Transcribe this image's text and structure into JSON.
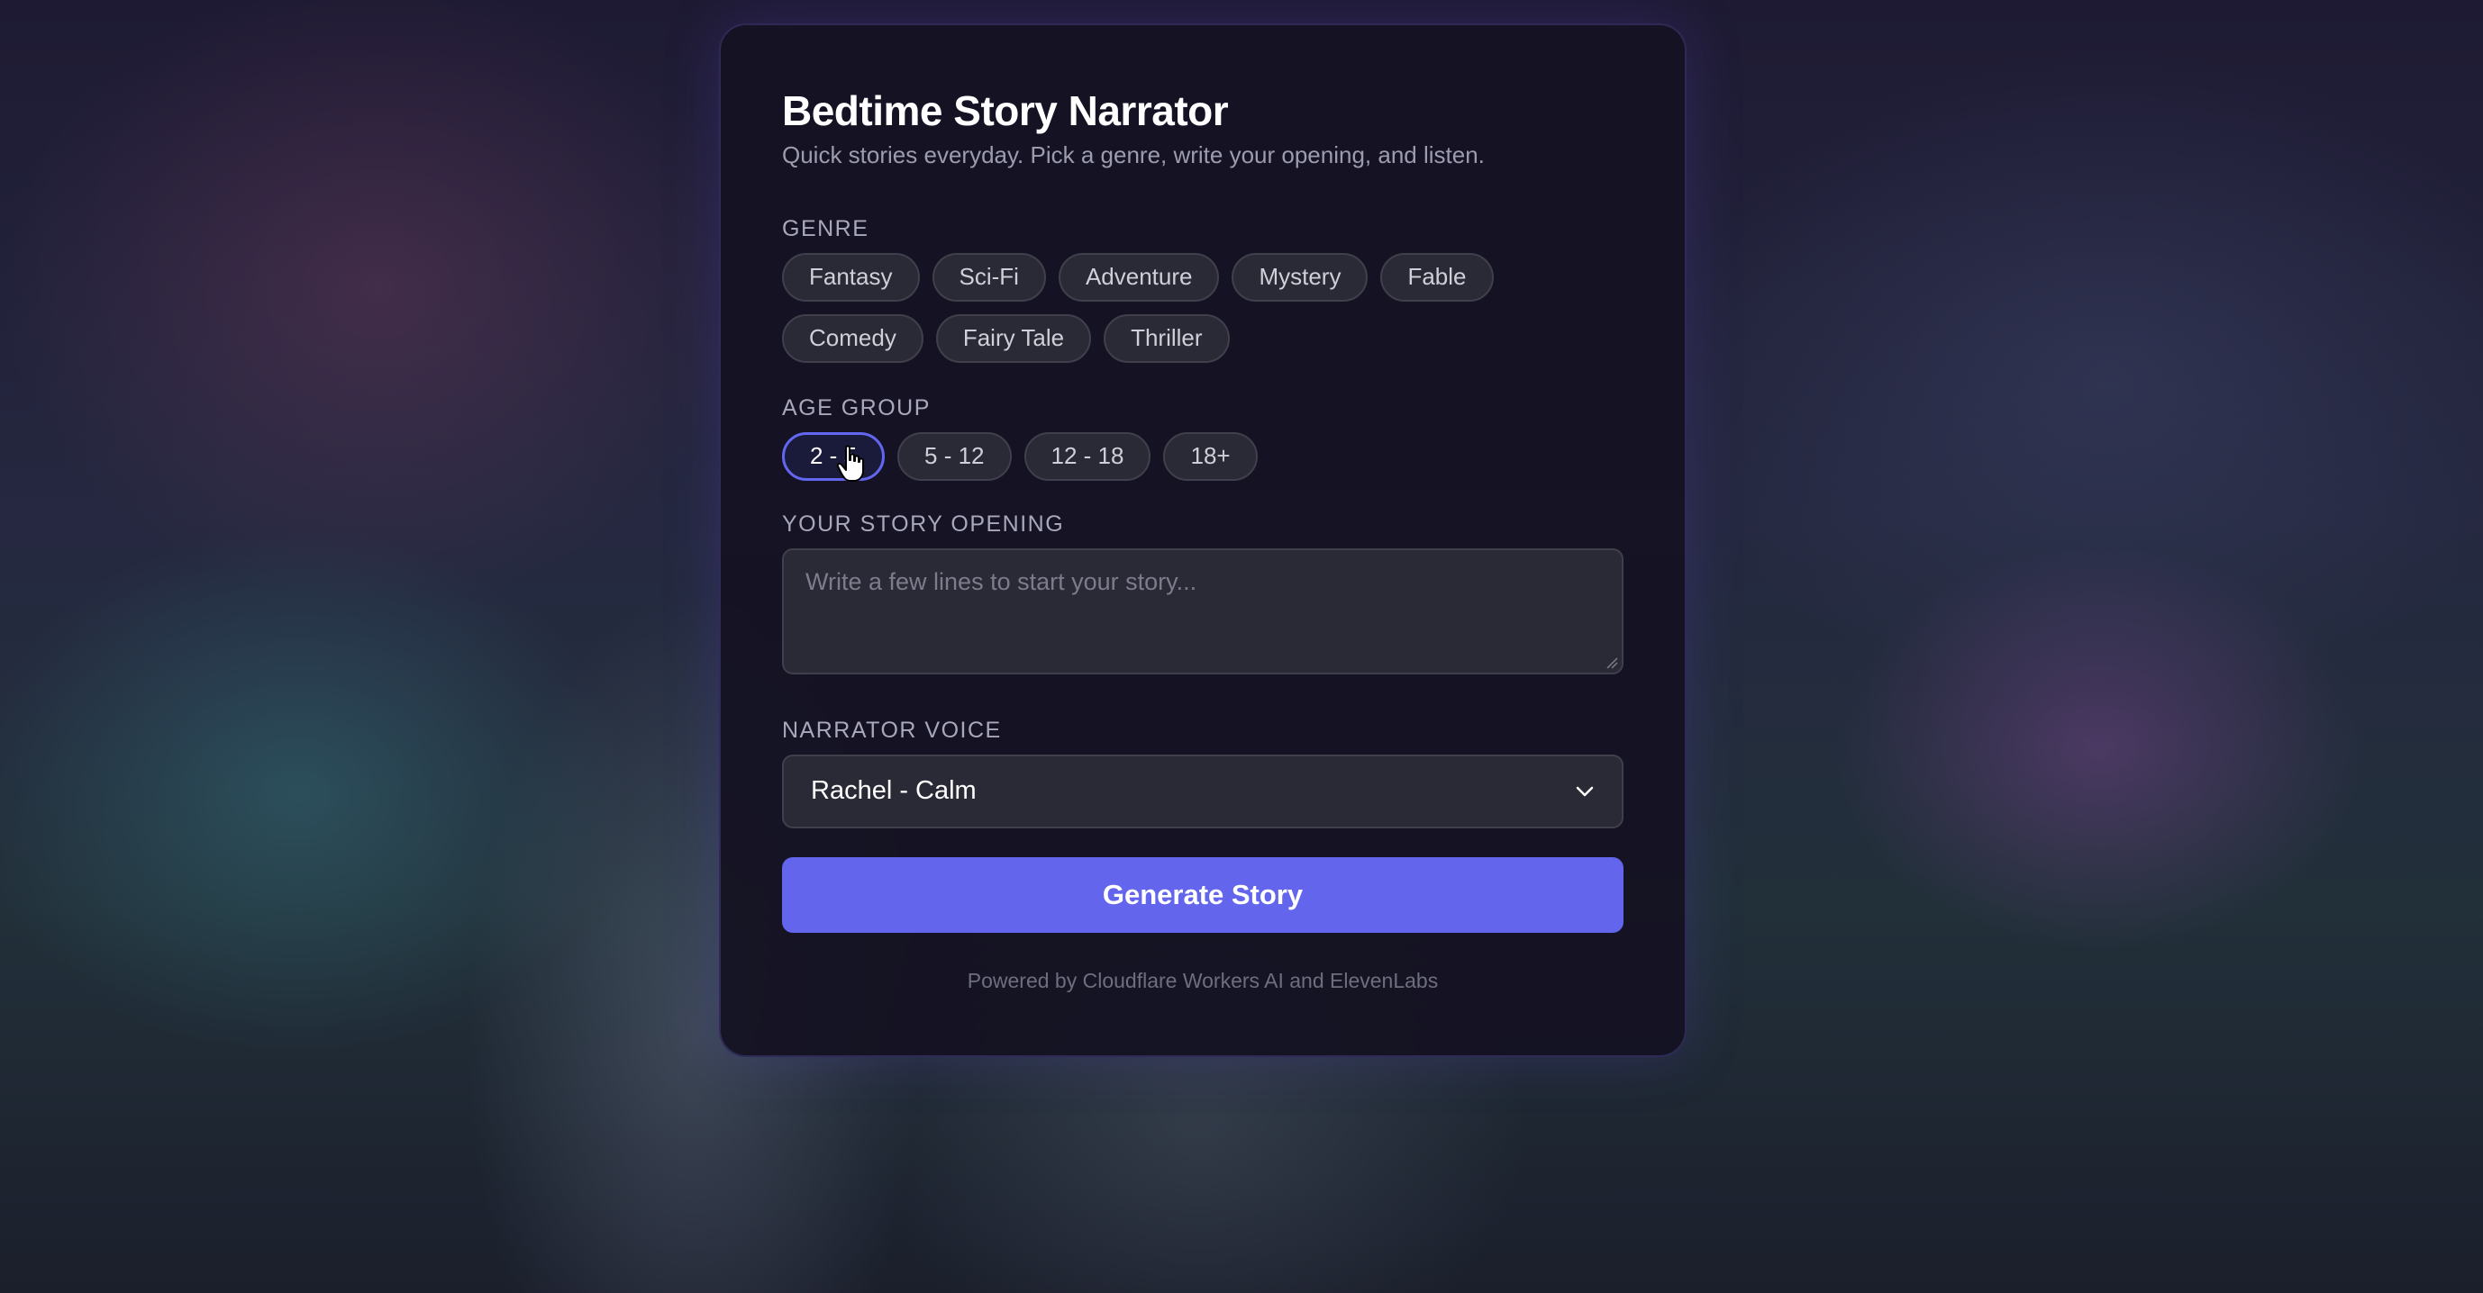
{
  "app": {
    "title": "Bedtime Story Narrator",
    "subtitle": "Quick stories everyday. Pick a genre, write your opening, and listen."
  },
  "genre": {
    "label": "GENRE",
    "options": [
      "Fantasy",
      "Sci-Fi",
      "Adventure",
      "Mystery",
      "Fable",
      "Comedy",
      "Fairy Tale",
      "Thriller"
    ]
  },
  "age_group": {
    "label": "AGE GROUP",
    "options": [
      "2 - 5",
      "5 - 12",
      "12 - 18",
      "18+"
    ],
    "selected": "2 - 5"
  },
  "story_opening": {
    "label": "YOUR STORY OPENING",
    "placeholder": "Write a few lines to start your story...",
    "value": ""
  },
  "narrator_voice": {
    "label": "NARRATOR VOICE",
    "selected": "Rachel - Calm"
  },
  "actions": {
    "generate_label": "Generate Story"
  },
  "footer": {
    "text": "Powered by Cloudflare Workers AI and ElevenLabs"
  },
  "colors": {
    "accent": "#6366f1",
    "card_bg": "#141222",
    "chip_bg": "#2a2a36"
  }
}
